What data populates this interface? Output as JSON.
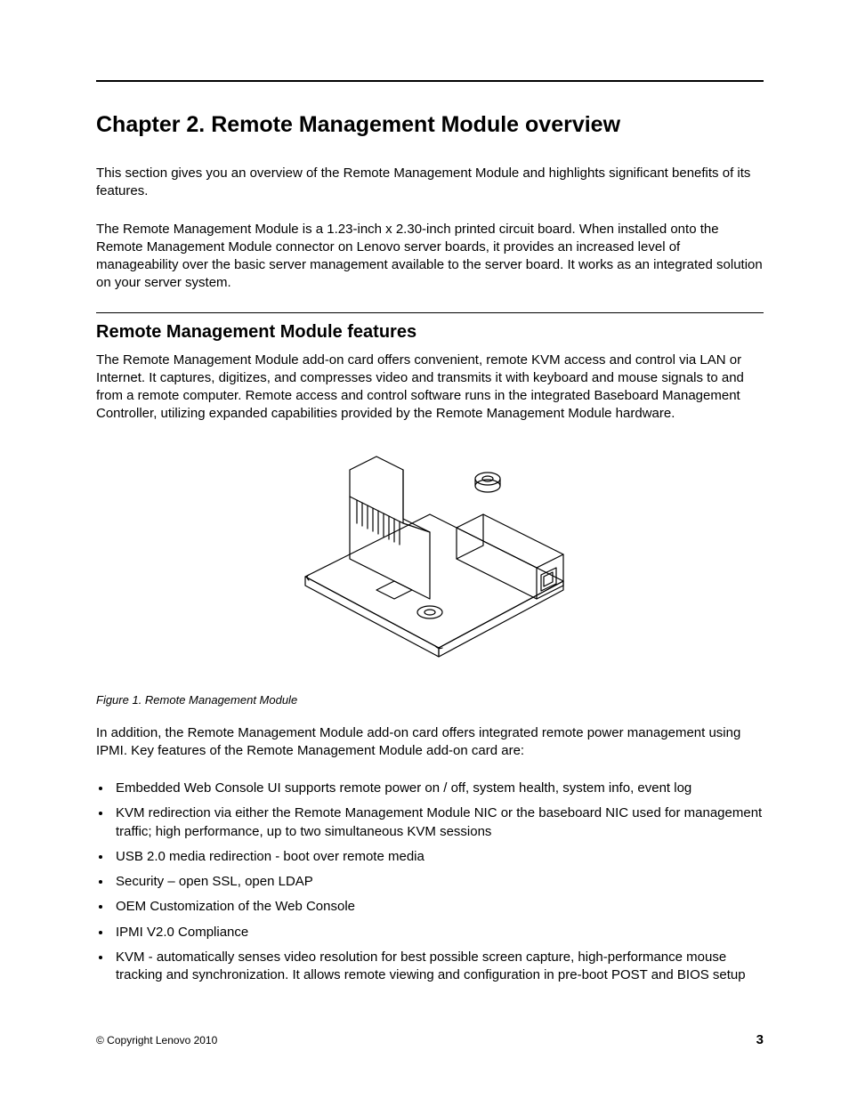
{
  "chapter": {
    "title": "Chapter 2.   Remote Management Module overview",
    "intro_p1": "This section gives you an overview of the Remote Management Module and highlights significant benefits of its features.",
    "intro_p2": "The Remote Management Module is a 1.23-inch x 2.30-inch printed circuit board. When installed onto the Remote Management Module connector on Lenovo server boards, it provides an increased level of manageability over the basic server management available to the server board. It works as an integrated solution on your server system."
  },
  "section": {
    "heading": "Remote Management Module features",
    "p1": "The Remote Management Module add-on card offers convenient, remote KVM access and control via LAN or Internet. It captures, digitizes, and compresses video and transmits it with keyboard and mouse signals to and from a remote computer. Remote access and control software runs in the integrated Baseboard Management Controller, utilizing expanded capabilities provided by the Remote Management Module hardware.",
    "figure_caption": "Figure 1.  Remote Management Module",
    "p2": "In addition, the Remote Management Module add-on card offers integrated remote power management using IPMI. Key features of the Remote Management Module add-on card are:",
    "bullets": [
      "Embedded Web Console UI supports remote power on / off, system health, system info, event log",
      "KVM redirection via either the Remote Management Module NIC or the baseboard NIC used for management traffic; high performance, up to two simultaneous KVM sessions",
      "USB 2.0 media redirection - boot over remote media",
      "Security – open SSL, open LDAP",
      "OEM Customization of the Web Console",
      "IPMI V2.0 Compliance",
      "KVM - automatically senses video resolution for best possible screen capture, high-performance mouse tracking and synchronization. It allows remote viewing and configuration in pre-boot POST and BIOS setup"
    ]
  },
  "footer": {
    "copyright": "© Copyright Lenovo 2010",
    "page_number": "3"
  }
}
